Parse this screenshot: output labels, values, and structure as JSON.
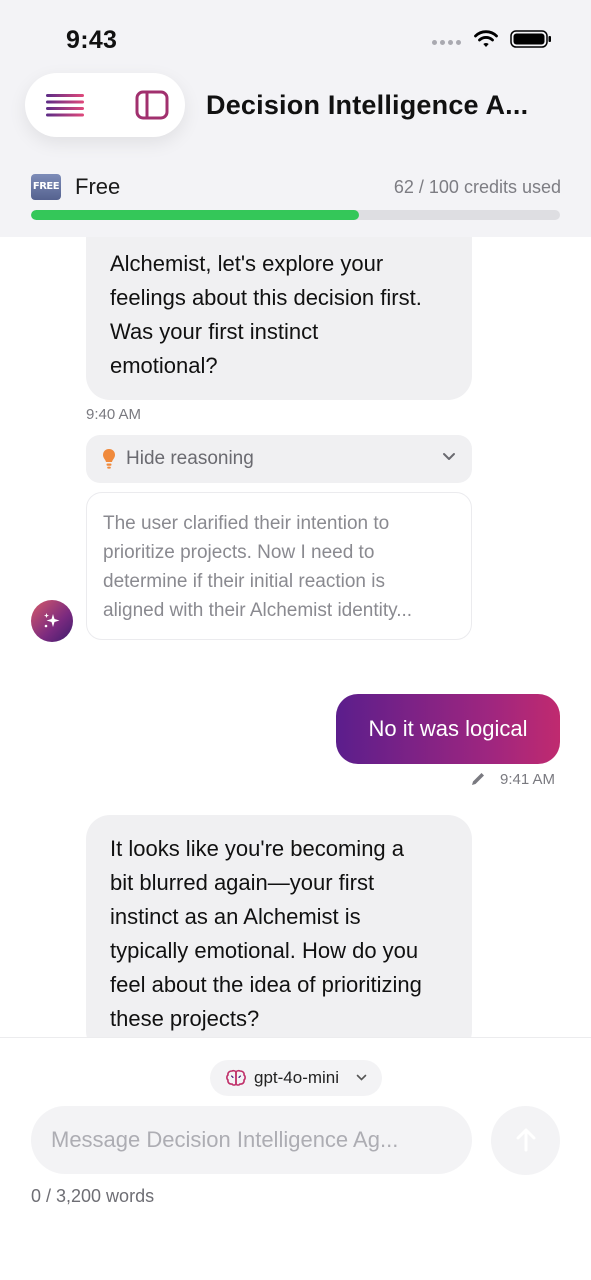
{
  "status_bar": {
    "time": "9:43",
    "icons": [
      "cell-dots-icon",
      "wifi-icon",
      "battery-icon"
    ]
  },
  "header": {
    "title": "Decision Intelligence A...",
    "icons": [
      "menu-icon",
      "sidebar-icon"
    ],
    "colors": {
      "menu_gradient": [
        "#5b2b86",
        "#e0487a"
      ],
      "sidebar_icon": "#a1306e"
    }
  },
  "plan": {
    "badge": "FREE",
    "name": "Free",
    "credits_label": "62 / 100 credits used",
    "credits_fraction": 0.62,
    "progress_color": "#34c759"
  },
  "messages": {
    "m1": {
      "lines": [
        "Alchemist, let's explore your",
        "feelings about this decision first.",
        "Was your first instinct",
        "emotional?"
      ],
      "time": "9:40 AM"
    },
    "reasoning": {
      "toggle_label": "Hide reasoning",
      "lines": [
        "The user clarified their intention to",
        "prioritize projects. Now I need to",
        "determine if their initial reaction is",
        "aligned with their Alchemist identity..."
      ],
      "icons": [
        "lightbulb-icon",
        "chevron-down-icon",
        "sparkle-icon"
      ]
    },
    "m2": {
      "text": "No it was logical",
      "time": "9:41 AM",
      "icons": [
        "pencil-icon"
      ],
      "colors": {
        "gradient": [
          "#5b1e8c",
          "#c02a6f"
        ]
      }
    },
    "m3": {
      "lines": [
        "It looks like you're becoming a",
        "bit blurred again—your first",
        "instinct as an Alchemist is",
        "typically emotional. How do you",
        "feel about the idea of prioritizing",
        "these projects?"
      ]
    }
  },
  "composer": {
    "model": "gpt-4o-mini",
    "placeholder": "Message Decision Intelligence Ag...",
    "word_count": "0 / 3,200 words",
    "icons": [
      "brain-icon",
      "chevron-down-icon",
      "send-arrow-icon"
    ]
  }
}
